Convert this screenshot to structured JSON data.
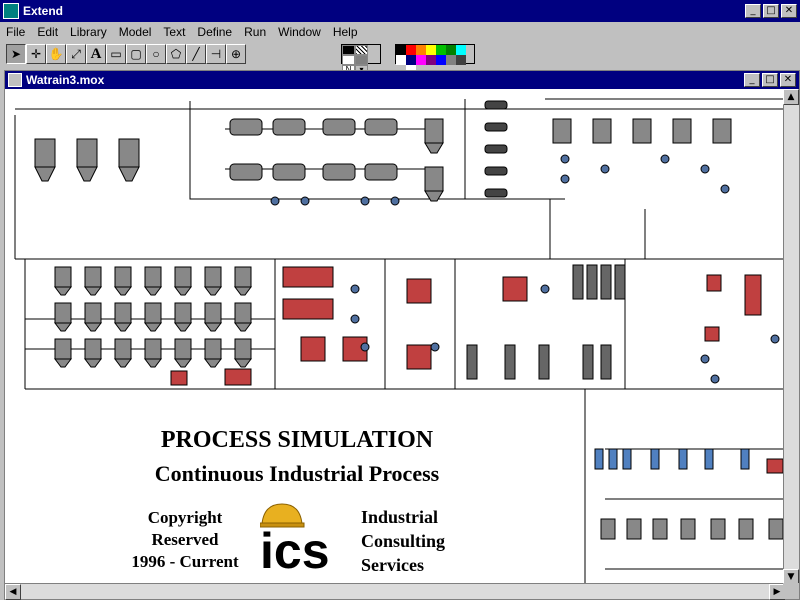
{
  "app": {
    "title": "Extend"
  },
  "window_buttons": {
    "minimize": "_",
    "maximize": "□",
    "close": "✕"
  },
  "menu": [
    "File",
    "Edit",
    "Library",
    "Model",
    "Text",
    "Define",
    "Run",
    "Window",
    "Help"
  ],
  "tools": [
    {
      "name": "pointer",
      "icon": "arrow-pointer-icon",
      "glyph": "➤"
    },
    {
      "name": "crosshair",
      "icon": "crosshair-icon",
      "glyph": "✛"
    },
    {
      "name": "hand",
      "icon": "hand-icon",
      "glyph": "✋"
    },
    {
      "name": "clone",
      "icon": "clone-icon",
      "glyph": "⤢"
    },
    {
      "name": "text",
      "icon": "text-tool-icon",
      "glyph": "A"
    },
    {
      "name": "rectangle",
      "icon": "rectangle-icon",
      "glyph": "▭"
    },
    {
      "name": "rounded-rectangle",
      "icon": "rounded-rectangle-icon",
      "glyph": "▢"
    },
    {
      "name": "oval",
      "icon": "oval-icon",
      "glyph": "○"
    },
    {
      "name": "polygon",
      "icon": "polygon-icon",
      "glyph": "⬠"
    },
    {
      "name": "line",
      "icon": "line-icon",
      "glyph": "╱"
    },
    {
      "name": "right-angle-line",
      "icon": "right-angle-line-icon",
      "glyph": "⊣"
    },
    {
      "name": "cursor",
      "icon": "cursor-icon",
      "glyph": "⊕"
    }
  ],
  "pattern_label": "N",
  "palette_colors": [
    "#000000",
    "#ff0000",
    "#ff8000",
    "#ffff00",
    "#00c000",
    "#008000",
    "#00ffff",
    "#ffffff",
    "#000080",
    "#ff00ff",
    "#800080",
    "#0000ff",
    "#808080",
    "#404040",
    "#c0c0c0",
    "#ffffff"
  ],
  "document": {
    "title": "Watrain3.mox"
  },
  "headline": {
    "line1": "PROCESS SIMULATION",
    "line2": "Continuous Industrial Process"
  },
  "copyright": {
    "line1": "Copyright",
    "line2": "Reserved",
    "line3": "1996 - Current"
  },
  "logo": {
    "text": "ics",
    "hat_color": "#e8b020"
  },
  "company": {
    "line1": "Industrial",
    "line2": "Consulting",
    "line3": "Services"
  }
}
